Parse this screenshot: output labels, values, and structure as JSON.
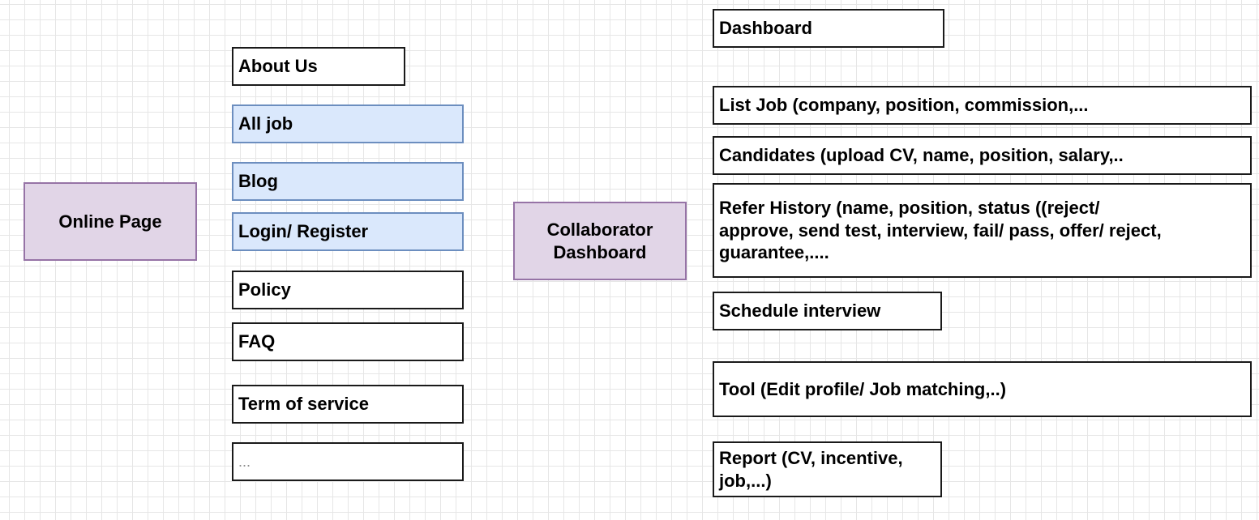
{
  "left_root": {
    "label": "Online Page",
    "fill": "#e1d5e7",
    "stroke": "#9673a6"
  },
  "online_items": [
    {
      "label": "About Us",
      "style": "plain"
    },
    {
      "label": "All job",
      "style": "blue"
    },
    {
      "label": "Blog",
      "style": "blue"
    },
    {
      "label": "Login/ Register",
      "style": "blue"
    },
    {
      "label": "Policy",
      "style": "plain"
    },
    {
      "label": "FAQ",
      "style": "plain"
    },
    {
      "label": "Term of service",
      "style": "plain"
    },
    {
      "label": "...",
      "style": "plain"
    }
  ],
  "center_root": {
    "label": "Collaborator Dashboard",
    "fill": "#e1d5e7",
    "stroke": "#9673a6"
  },
  "dashboard_items": [
    {
      "label": "Dashboard"
    },
    {
      "label": "List Job (company, position, commission,..."
    },
    {
      "label": "Candidates (upload CV, name, position, salary,.."
    },
    {
      "label": "Refer History (name, position, status ((reject/ approve, send test, interview, fail/ pass, offer/ reject, guarantee,...."
    },
    {
      "label": "Schedule interview"
    },
    {
      "label": "Tool (Edit profile/ Job matching,..)"
    },
    {
      "label": "Report (CV, incentive, job,...)"
    }
  ],
  "colors": {
    "highlight_fill": "#dae8fc",
    "highlight_stroke": "#6c8ebf",
    "root_fill": "#e1d5e7",
    "root_stroke": "#9673a6",
    "grid": "#e6e6e6"
  }
}
